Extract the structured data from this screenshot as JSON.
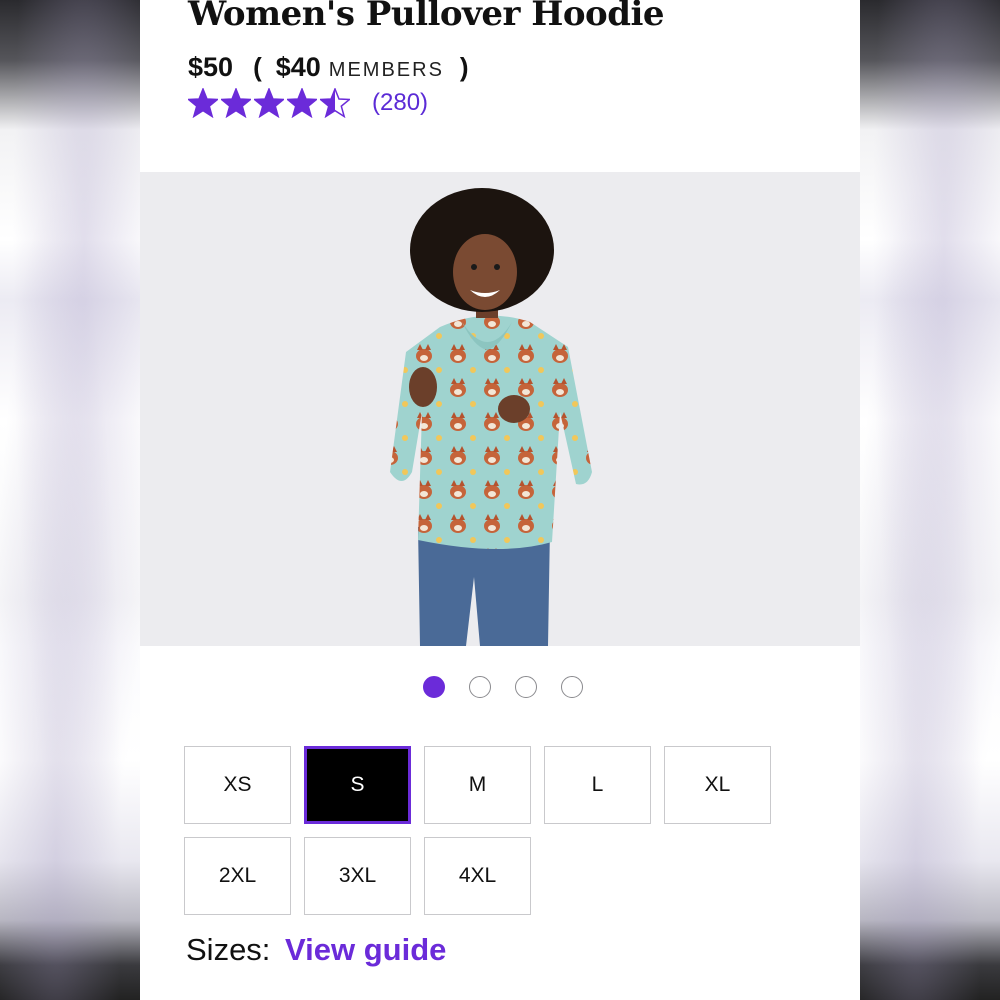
{
  "product": {
    "title": "Women's Pullover Hoodie",
    "price": "$50",
    "member_price": "$40",
    "members_label": "MEMBERS",
    "paren_open": "(",
    "paren_close": ")",
    "rating_value": 4.5,
    "rating_max": 5,
    "rating_count": "(280)"
  },
  "gallery": {
    "image_count": 4,
    "active_index": 0,
    "image_icon": "model-wearing-hoodie-photo"
  },
  "sizes": {
    "options": [
      "XS",
      "S",
      "M",
      "L",
      "XL",
      "2XL",
      "3XL",
      "4XL"
    ],
    "selected": "S"
  },
  "size_guide": {
    "label": "Sizes:",
    "link": "View guide"
  },
  "colors": {
    "accent": "#6b2bd9",
    "rating": "#6b2bd9",
    "hoodie": "#9fd3cf",
    "pants": "#4a6a97"
  }
}
